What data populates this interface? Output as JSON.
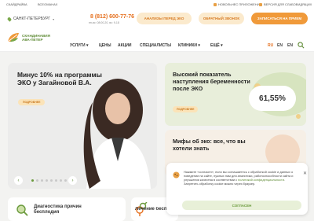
{
  "topbar": {
    "left": [
      "СКАЙДРАЙВА",
      "ВСЕОМАНАХ"
    ],
    "right": [
      "НОВОЛЬНЕС ПРИЛОЖЕНИЕ",
      "ВЕРСИЯ ДЛЯ СЛАБОВИДЯЩИХ"
    ]
  },
  "header": {
    "city": "САНКТ-ПЕТЕРБУРГ",
    "phone": "8 (812) 600-77-76",
    "phone_sub": "пн-вс: 08:00-20, вс: 9-18",
    "btn_analysis": "АНАЛИЗЫ ПЕРЕД ЭКО",
    "btn_call": "ОБРАТНЫЙ ЗВОНОК",
    "btn_appointment": "ЗАПИСАТЬСЯ НА ПРИЕМ"
  },
  "logo": {
    "line1": "СКАНДИНАВИЯ",
    "line2": "АВА-ПЕТЕР"
  },
  "nav": [
    "УСЛУГИ",
    "ЦЕНЫ",
    "АКЦИИ",
    "СПЕЦИАЛИСТЫ",
    "КЛИНИКИ",
    "ЕЩЁ"
  ],
  "lang": [
    "RU",
    "EN",
    "EN"
  ],
  "hero": {
    "title": "Минус 10% на программы ЭКО у Загайновой В.А.",
    "chip": "ПОДРОБНЕЕ",
    "prev": "‹",
    "next": "›"
  },
  "cards": [
    {
      "title": "Высокий показатель наступления беременности после ЭКО",
      "chip": "ПОДРОБНЕЕ",
      "stat": "61,55%"
    },
    {
      "title": "Мифы об эко: все, что вы хотели знать"
    }
  ],
  "bottom": [
    {
      "title": "Диагностика причин бесплодия"
    },
    {
      "title": "Лечение беспл"
    }
  ],
  "cookie": {
    "text": "Нажмите «согласен», если вы соглашаетесь с обработкой cookie и данных о поведении на сайте, нужных нам для аналитики, работоспособности сайта и улучшения качества в соответствии с ",
    "link": "политикой конфиденциальности",
    "text2": ". Запретить обработку cookie можно через браузер.",
    "ok": "СОГЛАСЕН",
    "close": "✕"
  },
  "colors": {
    "brand_green": "#6a9a3c",
    "brand_orange": "#f09a3a"
  }
}
